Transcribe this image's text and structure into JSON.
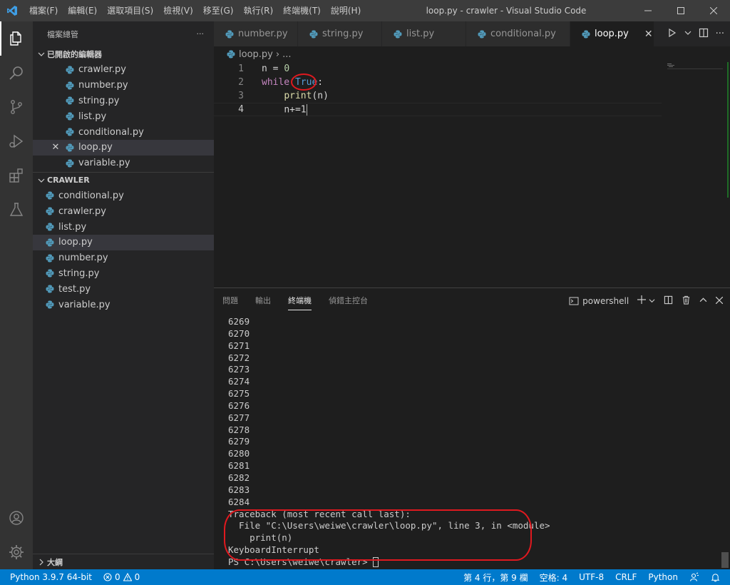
{
  "window": {
    "title": "loop.py - crawler - Visual Studio Code",
    "menu": [
      "檔案(F)",
      "編輯(E)",
      "選取項目(S)",
      "檢視(V)",
      "移至(G)",
      "執行(R)",
      "終端機(T)",
      "說明(H)"
    ]
  },
  "sidebar": {
    "header": "檔案總管",
    "more": "···",
    "open_editors_title": "已開啟的編輯器",
    "open_editors": [
      "crawler.py",
      "number.py",
      "string.py",
      "list.py",
      "conditional.py",
      "loop.py",
      "variable.py"
    ],
    "folder_title": "CRAWLER",
    "files": [
      "conditional.py",
      "crawler.py",
      "list.py",
      "loop.py",
      "number.py",
      "string.py",
      "test.py",
      "variable.py"
    ],
    "outline_title": "大綱"
  },
  "tabs": [
    "number.py",
    "string.py",
    "list.py",
    "conditional.py",
    "loop.py"
  ],
  "breadcrumb": {
    "file": "loop.py",
    "rest": "..."
  },
  "editor": {
    "line_numbers": [
      "1",
      "2",
      "3",
      "4"
    ],
    "line1": {
      "var": "n",
      "op": " = ",
      "num": "0"
    },
    "line2": {
      "kw": "while",
      "sp": " ",
      "const": "True",
      "colon": ":"
    },
    "line3": {
      "indent": "    ",
      "fn": "print",
      "args": "(n)"
    },
    "line4": {
      "indent": "    ",
      "code": "n+=1"
    }
  },
  "panel": {
    "tabs": [
      "問題",
      "輸出",
      "終端機",
      "偵錯主控台"
    ],
    "active_tab": "終端機",
    "shell": "powershell",
    "terminal_lines": [
      "6269",
      "6270",
      "6271",
      "6272",
      "6273",
      "6274",
      "6275",
      "6276",
      "6277",
      "6278",
      "6279",
      "6280",
      "6281",
      "6282",
      "6283",
      "6284",
      "Traceback (most recent call last):",
      "  File \"C:\\Users\\weiwe\\crawler\\loop.py\", line 3, in <module>",
      "    print(n)",
      "KeyboardInterrupt"
    ],
    "prompt": "PS C:\\Users\\weiwe\\crawler> "
  },
  "statusbar": {
    "python": "Python 3.9.7 64-bit",
    "errors": "0",
    "warnings": "0",
    "position": "第 4 行，第 9 欄",
    "spaces": "空格: 4",
    "encoding": "UTF-8",
    "eol": "CRLF",
    "language": "Python"
  },
  "colors": {
    "accent": "#007acc",
    "annotation": "#e0191f",
    "python_icon": "#519aba"
  }
}
